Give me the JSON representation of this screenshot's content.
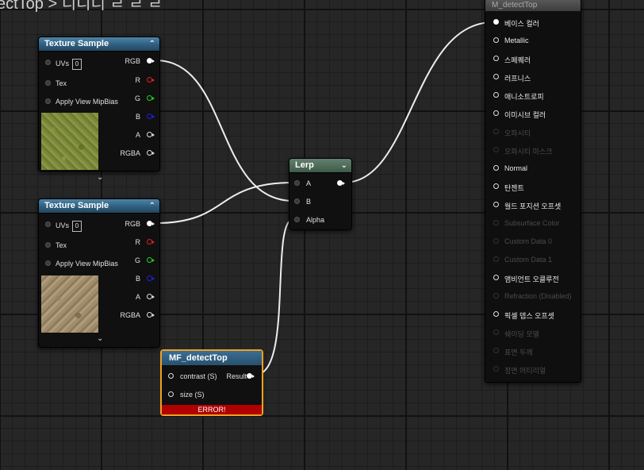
{
  "breadcrumb": "ectTop > 디디디 ㄹ ㄹ ㄹ",
  "texture_nodes": [
    {
      "title": "Texture Sample",
      "inputs": [
        "UVs",
        "Tex",
        "Apply View MipBias"
      ],
      "uv_value": "0",
      "outputs": [
        "RGB",
        "R",
        "G",
        "B",
        "A",
        "RGBA"
      ],
      "thumbnail": "grass"
    },
    {
      "title": "Texture Sample",
      "inputs": [
        "UVs",
        "Tex",
        "Apply View MipBias"
      ],
      "uv_value": "0",
      "outputs": [
        "RGB",
        "R",
        "G",
        "B",
        "A",
        "RGBA"
      ],
      "thumbnail": "dirt"
    }
  ],
  "lerp": {
    "title": "Lerp",
    "inputs": [
      "A",
      "B",
      "Alpha"
    ]
  },
  "mf": {
    "title": "MF_detectTop",
    "inputs": [
      "contrast (S)",
      "size (S)"
    ],
    "output": "Result",
    "error": "ERROR!"
  },
  "result": {
    "title": "M_detectTop",
    "pins": [
      {
        "label": "베이스 컬러",
        "enabled": true,
        "connected": true
      },
      {
        "label": "Metallic",
        "enabled": true,
        "connected": false
      },
      {
        "label": "스페퀘러",
        "enabled": true,
        "connected": false
      },
      {
        "label": "러프니스",
        "enabled": true,
        "connected": false
      },
      {
        "label": "애니소트로피",
        "enabled": true,
        "connected": false
      },
      {
        "label": "이미시브 컬러",
        "enabled": true,
        "connected": false
      },
      {
        "label": "오파시티",
        "enabled": false,
        "connected": false
      },
      {
        "label": "오파시티 마스크",
        "enabled": false,
        "connected": false
      },
      {
        "label": "Normal",
        "enabled": true,
        "connected": false
      },
      {
        "label": "탄젠트",
        "enabled": true,
        "connected": false
      },
      {
        "label": "월드 포지션 오프셋",
        "enabled": true,
        "connected": false
      },
      {
        "label": "Subsurface Color",
        "enabled": false,
        "connected": false
      },
      {
        "label": "Custom Data 0",
        "enabled": false,
        "connected": false
      },
      {
        "label": "Custom Data 1",
        "enabled": false,
        "connected": false
      },
      {
        "label": "앰비언트 오클루전",
        "enabled": true,
        "connected": false
      },
      {
        "label": "Refraction (Disabled)",
        "enabled": false,
        "connected": false
      },
      {
        "label": "픽셀 뎁스 오프셋",
        "enabled": true,
        "connected": false
      },
      {
        "label": "쉐이딩 모델",
        "enabled": false,
        "connected": false
      },
      {
        "label": "표면 두께",
        "enabled": false,
        "connected": false
      },
      {
        "label": "정면 머티리얼",
        "enabled": false,
        "connected": false
      }
    ]
  },
  "colors": {
    "accent_selected": "#f0a020",
    "error": "#b00000",
    "header_blue": "#2f5f80"
  }
}
